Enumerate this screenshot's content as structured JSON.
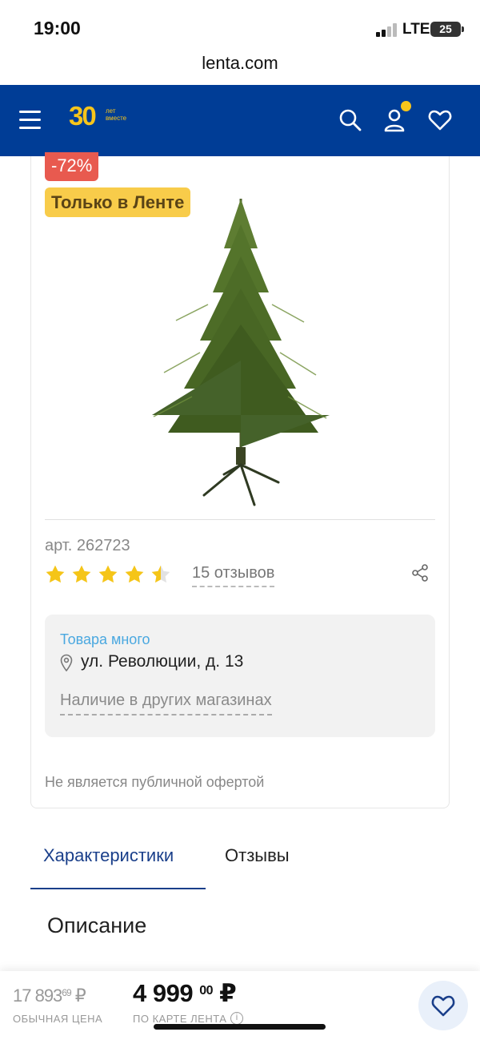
{
  "status_bar": {
    "time": "19:00",
    "network": "LTE",
    "battery": "25"
  },
  "browser": {
    "url": "lenta.com"
  },
  "header": {
    "logo_number": "30",
    "logo_tagline_1": "лет",
    "logo_tagline_2": "вместе",
    "brand_color": "#003d96",
    "accent_color": "#f7c51b"
  },
  "product": {
    "discount": "-72%",
    "exclusive_label": "Только в Ленте",
    "sku": "арт. 262723",
    "rating": 4.5,
    "rating_max": 5,
    "reviews_link": "15 отзывов"
  },
  "stock": {
    "status": "Товара много",
    "address": "ул. Революции, д. 13",
    "other_stores_link": "Наличие в других магазинах"
  },
  "disclaimer": "Не является публичной офертой",
  "tabs": [
    {
      "label": "Характеристики",
      "active": true
    },
    {
      "label": "Отзывы",
      "active": false
    }
  ],
  "section": {
    "title": "Описание"
  },
  "price_bar": {
    "regular_price_main": "17 893",
    "regular_price_kopecks": "69",
    "currency": "₽",
    "regular_price_label": "ОБЫЧНАЯ ЦЕНА",
    "card_price_main": "4 999",
    "card_price_kopecks": "00",
    "card_price_label": "ПО КАРТЕ ЛЕНТА",
    "info_glyph": "i"
  }
}
